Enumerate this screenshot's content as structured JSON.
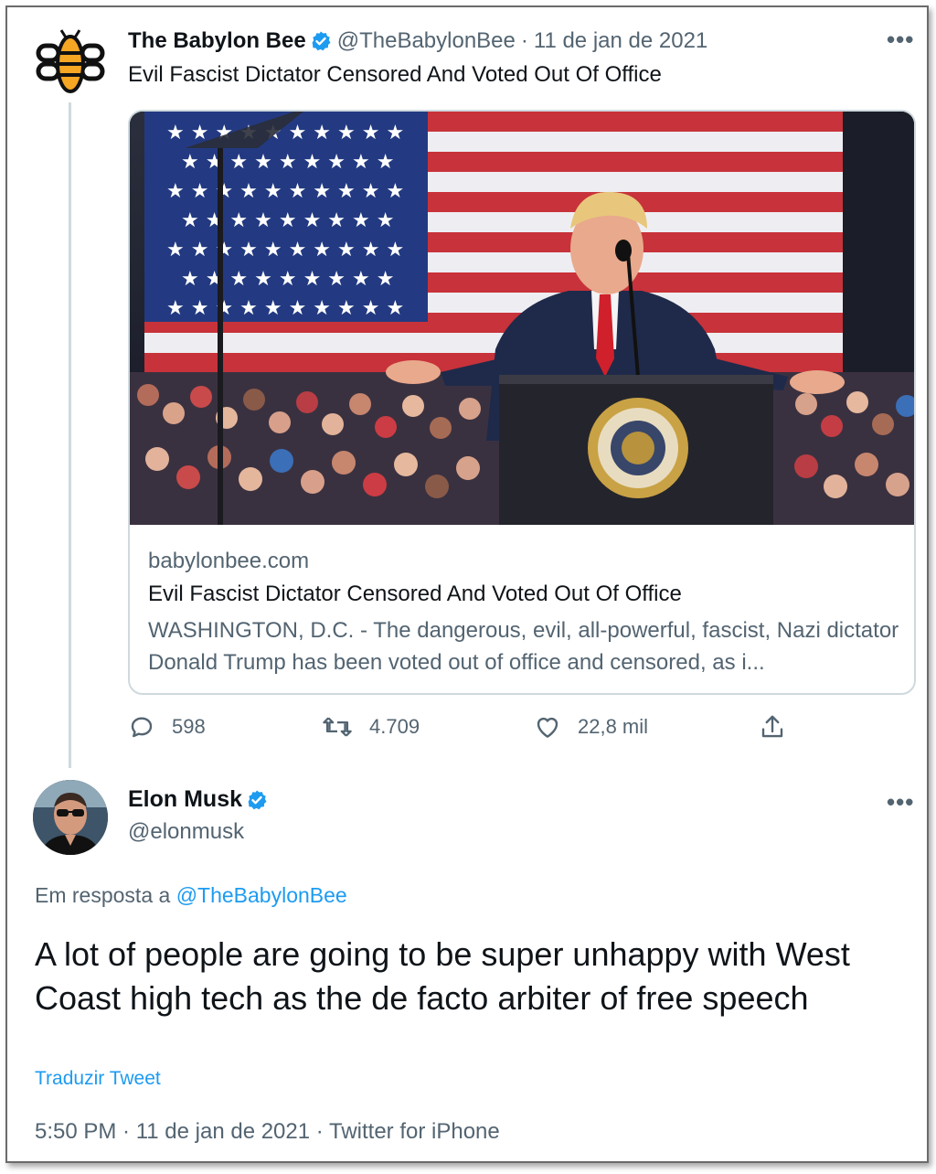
{
  "tweet1": {
    "display_name": "The Babylon Bee",
    "handle": "@TheBabylonBee",
    "separator": "·",
    "date": "11 de jan de 2021",
    "more": "•••",
    "text": "Evil Fascist Dictator Censored And Voted Out Of Office",
    "card": {
      "domain": "babylonbee.com",
      "title": "Evil Fascist Dictator Censored And Voted Out Of Office",
      "description": "WASHINGTON, D.C. - The dangerous, evil, all-powerful, fascist, Nazi dictator Donald Trump has been voted out of office and censored, as i..."
    },
    "actions": {
      "replies": "598",
      "retweets": "4.709",
      "likes": "22,8 mil"
    }
  },
  "tweet2": {
    "display_name": "Elon Musk",
    "handle": "@elonmusk",
    "more": "•••",
    "reply_prefix": "Em resposta a",
    "reply_handle": "@TheBabylonBee",
    "text": "A lot of people are going to be super unhappy with West Coast high tech as the de facto arbiter of free speech",
    "translate": "Traduzir Tweet",
    "meta": "5:50 PM · 11 de jan de 2021 · Twitter for iPhone"
  },
  "colors": {
    "text_primary": "#0f1419",
    "text_secondary": "#536471",
    "link": "#1d9bf0",
    "verified": "#1d9bf0",
    "border": "#cfd9de",
    "bee_yellow": "#f5a623"
  },
  "icons": [
    "babylon-bee-logo",
    "verified-badge-icon",
    "more-icon",
    "reply-icon",
    "retweet-icon",
    "like-icon",
    "share-icon"
  ]
}
